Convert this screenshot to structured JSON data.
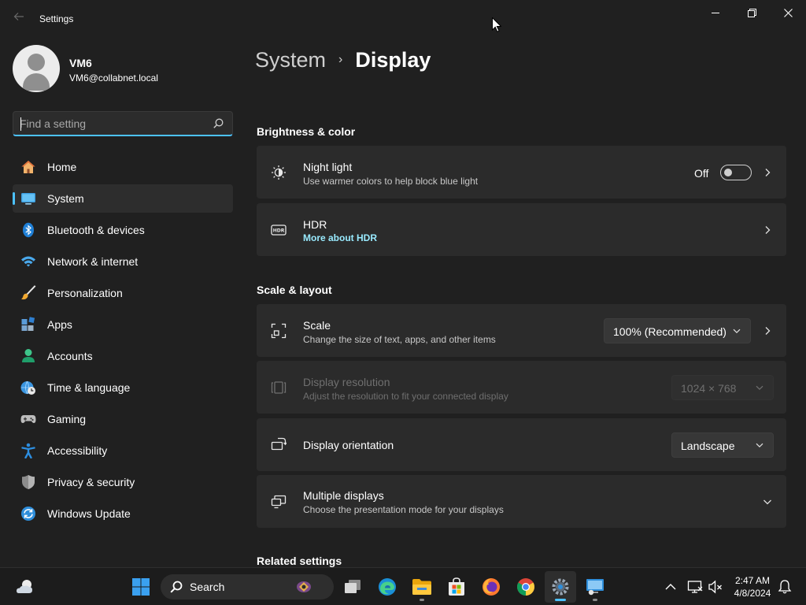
{
  "window": {
    "app_title": "Settings"
  },
  "user": {
    "name": "VM6",
    "email": "VM6@collabnet.local"
  },
  "search": {
    "placeholder": "Find a setting"
  },
  "sidebar": {
    "items": [
      {
        "label": "Home",
        "icon": "home-icon",
        "active": false
      },
      {
        "label": "System",
        "icon": "monitor-icon",
        "active": true
      },
      {
        "label": "Bluetooth & devices",
        "icon": "bluetooth-icon",
        "active": false
      },
      {
        "label": "Network & internet",
        "icon": "wifi-icon",
        "active": false
      },
      {
        "label": "Personalization",
        "icon": "brush-icon",
        "active": false
      },
      {
        "label": "Apps",
        "icon": "apps-icon",
        "active": false
      },
      {
        "label": "Accounts",
        "icon": "accounts-icon",
        "active": false
      },
      {
        "label": "Time & language",
        "icon": "clock-globe-icon",
        "active": false
      },
      {
        "label": "Gaming",
        "icon": "gamepad-icon",
        "active": false
      },
      {
        "label": "Accessibility",
        "icon": "accessibility-icon",
        "active": false
      },
      {
        "label": "Privacy & security",
        "icon": "shield-icon",
        "active": false
      },
      {
        "label": "Windows Update",
        "icon": "update-icon",
        "active": false
      }
    ]
  },
  "breadcrumb": {
    "parent": "System",
    "separator": "›",
    "current": "Display"
  },
  "sections": {
    "brightness": {
      "title": "Brightness & color",
      "night_light": {
        "title": "Night light",
        "subtitle": "Use warmer colors to help block blue light",
        "toggle_label": "Off",
        "on": false
      },
      "hdr": {
        "title": "HDR",
        "link": "More about HDR"
      }
    },
    "scale_layout": {
      "title": "Scale & layout",
      "scale": {
        "title": "Scale",
        "subtitle": "Change the size of text, apps, and other items",
        "value": "100% (Recommended)"
      },
      "resolution": {
        "title": "Display resolution",
        "subtitle": "Adjust the resolution to fit your connected display",
        "value": "1024 × 768",
        "disabled": true
      },
      "orientation": {
        "title": "Display orientation",
        "value": "Landscape"
      },
      "multiple": {
        "title": "Multiple displays",
        "subtitle": "Choose the presentation mode for your displays"
      }
    },
    "related": {
      "title": "Related settings"
    }
  },
  "taskbar": {
    "search_label": "Search",
    "apps": [
      "widgets-icon",
      "start-icon",
      "task-view-icon",
      "edge-icon",
      "file-explorer-icon",
      "store-icon",
      "firefox-icon",
      "chrome-icon",
      "settings-app-icon",
      "rdp-icon"
    ],
    "time": "2:47 AM",
    "date": "4/8/2024"
  },
  "colors": {
    "accent": "#4cc2ff",
    "link": "#99ebff",
    "background": "#202020",
    "card": "#2b2b2b"
  }
}
